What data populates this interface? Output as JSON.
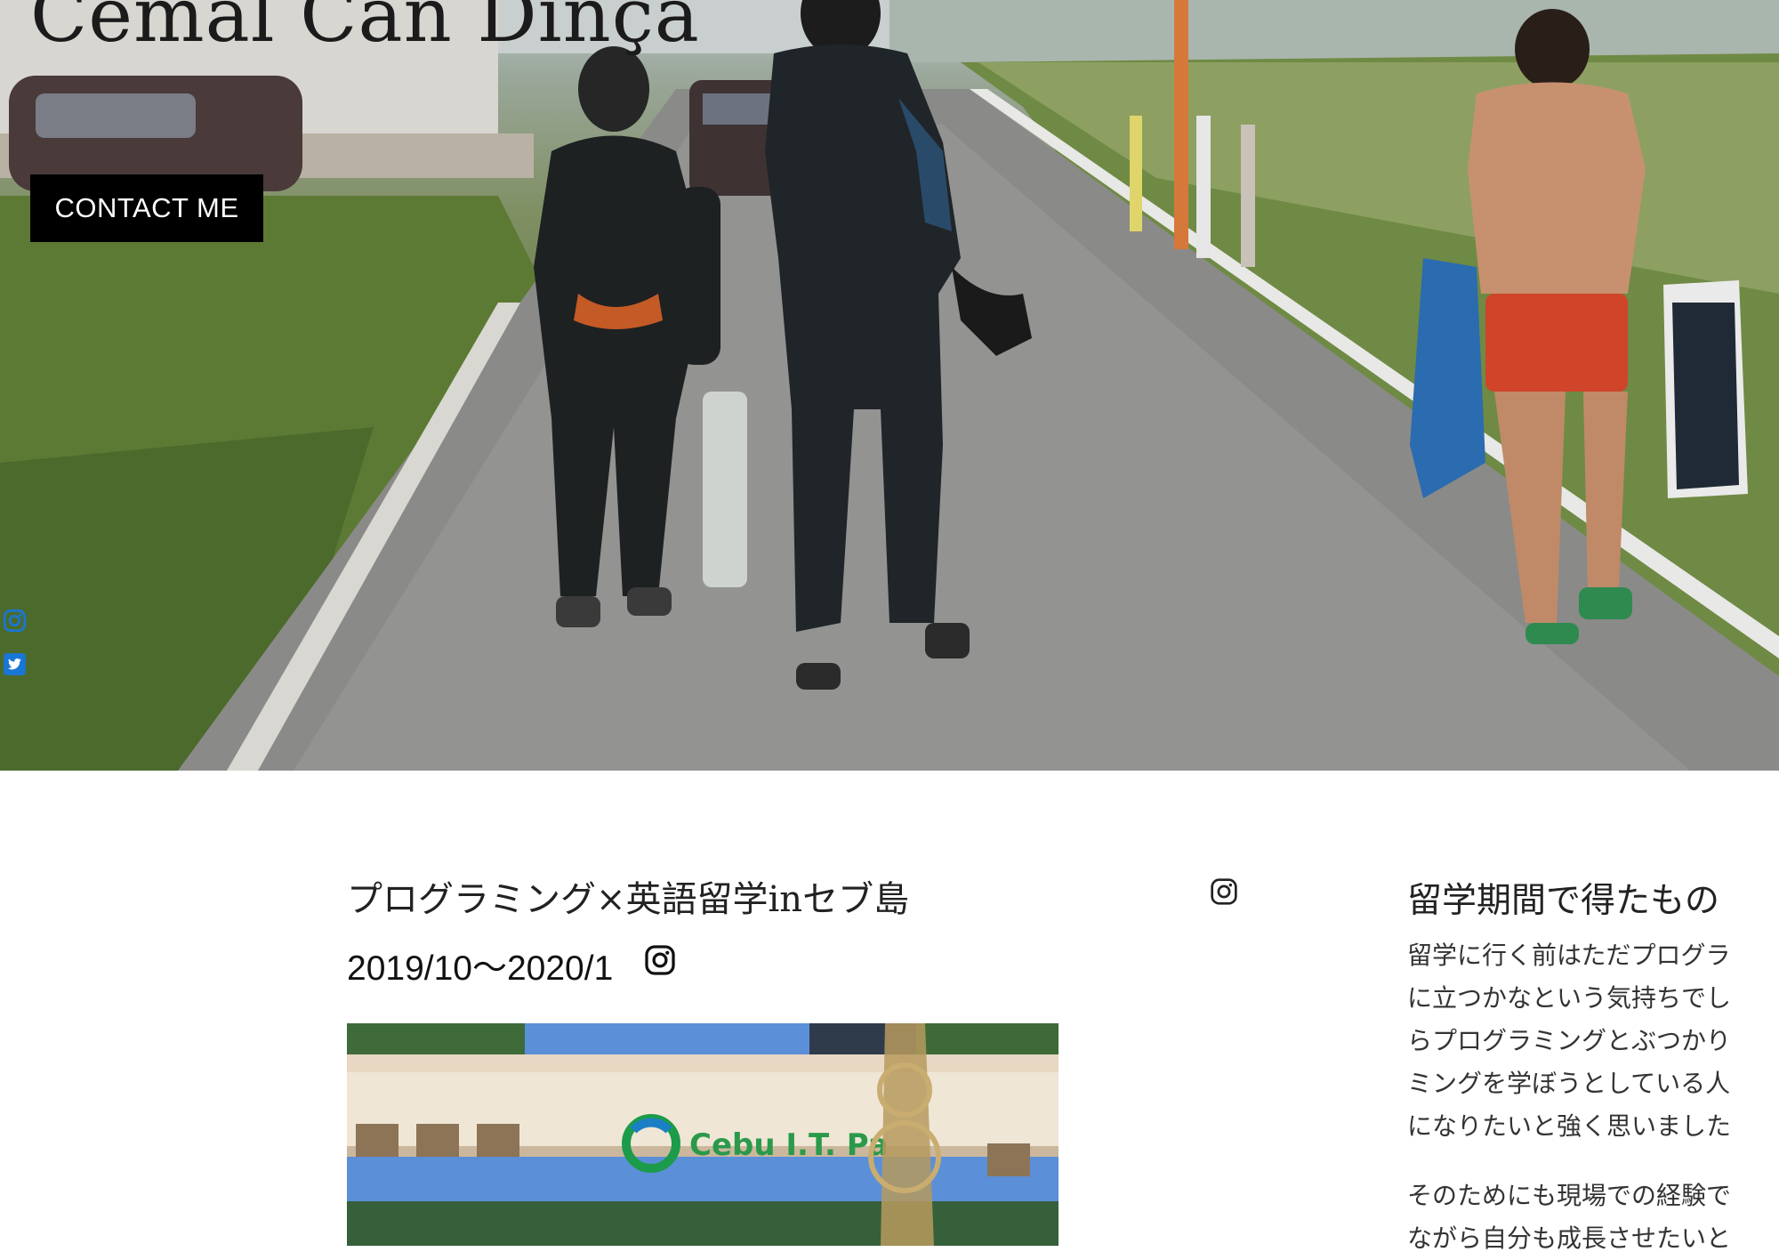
{
  "hero": {
    "title": "Cemal Can Dinça",
    "contact_label": "CONTACT ME"
  },
  "social": {
    "icons": [
      "instagram-icon",
      "twitter-icon"
    ],
    "color": "#1877d6"
  },
  "post": {
    "title": "プログラミング×英語留学inセブ島",
    "date": "2019/10〜2020/1",
    "photo_sign": "Cebu I.T. Pa"
  },
  "sidebar": {
    "heading": "留学期間で得たもの",
    "paragraph1": [
      "留学に行く前はただプログラ",
      "に立つかなという気持ちでし",
      "らプログラミングとぶつかり",
      "ミングを学ぼうとしている人",
      "になりたいと強く思いました"
    ],
    "paragraph2": [
      "そのためにも現場での経験で",
      "ながら自分も成長させたいと"
    ]
  }
}
